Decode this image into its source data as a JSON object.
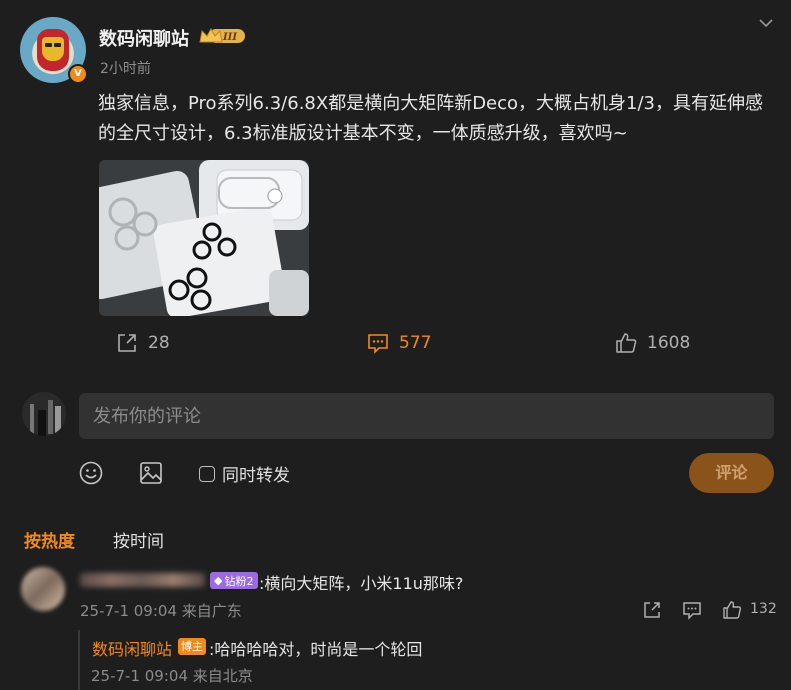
{
  "post": {
    "username": "数码闲聊站",
    "level_badge": "III",
    "verified_mark": "V",
    "time": "2小时前",
    "content": "独家信息，Pro系列6.3/6.8X都是横向大矩阵新Deco，大概占机身1/3，具有延伸感的全尺寸设计，6.3标准版设计基本不变，一体质感升级，喜欢吗~",
    "image_alt": "多款手机镜头膜产品图",
    "stats": {
      "reposts": "28",
      "comments": "577",
      "likes": "1608"
    }
  },
  "composer": {
    "placeholder": "发布你的评论",
    "repost_label": "同时转发",
    "submit_label": "评论"
  },
  "sort": {
    "hot": "按热度",
    "time": "按时间"
  },
  "comments": [
    {
      "fan_badge": "钻粉2",
      "text": ":横向大矩阵，小米11u那味?",
      "meta": "25-7-1 09:04 来自广东",
      "likes": "132",
      "reply": {
        "username": "数码闲聊站",
        "badge": "博主",
        "text": ":哈哈哈哈对，时尚是一个轮回",
        "meta": "25-7-1 09:04 来自北京"
      }
    }
  ],
  "colors": {
    "accent": "#f28a1b",
    "background": "#1e1e1e",
    "fan_badge": "#9b6be0"
  }
}
